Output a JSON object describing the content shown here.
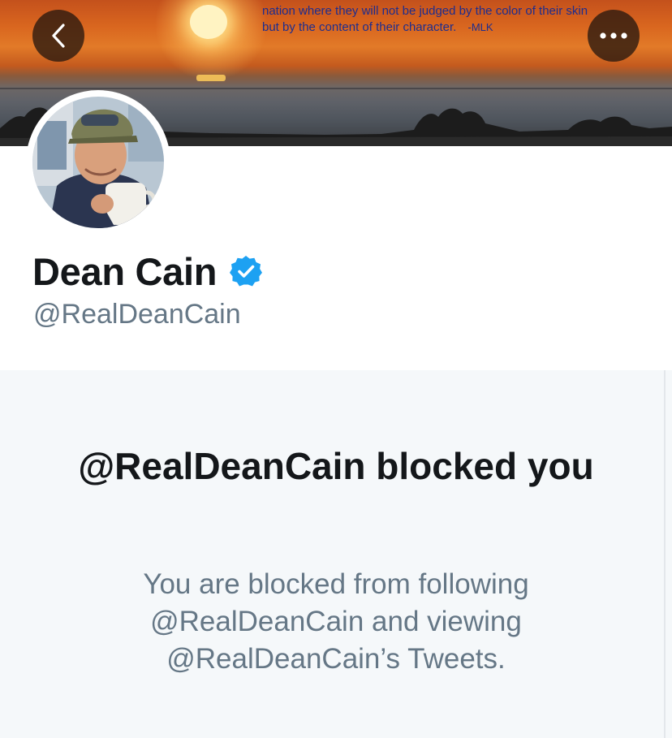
{
  "banner": {
    "quote_text": "nation where they will not be judged by the color of their skin but by the content of their character.",
    "quote_attribution": "-MLK"
  },
  "nav": {
    "back_icon": "chevron-left-icon",
    "more_icon": "more-horizontal-icon"
  },
  "profile": {
    "display_name": "Dean Cain",
    "verified_icon": "verified-badge-icon",
    "handle": "@RealDeanCain"
  },
  "blocked": {
    "title": "@RealDeanCain blocked you",
    "description": "You are blocked from following @RealDeanCain and viewing @RealDeanCain’s Tweets."
  },
  "colors": {
    "verified_blue": "#1da1f2",
    "handle_gray": "#657786",
    "panel_bg": "#f5f8fa",
    "text_dark": "#14171a",
    "quote_blue": "#1d2d8f"
  }
}
